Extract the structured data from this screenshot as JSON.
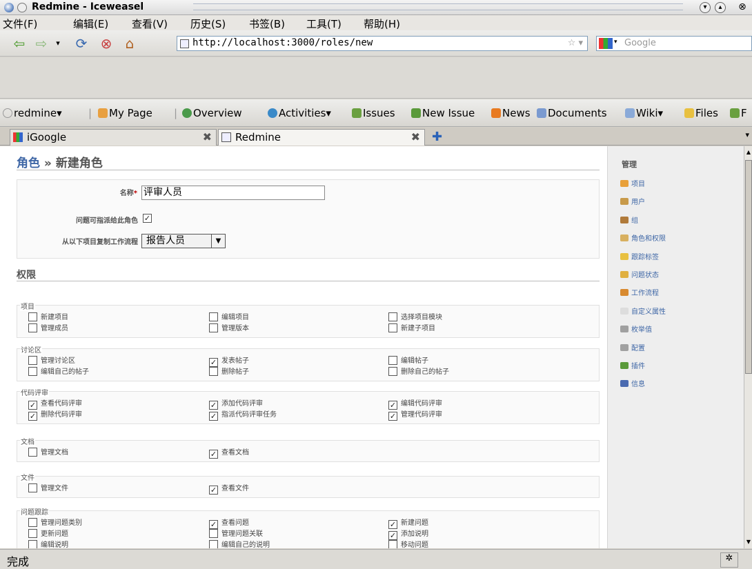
{
  "window": {
    "title": "Redmine - Iceweasel"
  },
  "menu": [
    "文件(F)",
    "编辑(E)",
    "查看(V)",
    "历史(S)",
    "书签(B)",
    "工具(T)",
    "帮助(H)"
  ],
  "nav": {
    "url": "http://localhost:3000/roles/new",
    "search_placeholder": "Google"
  },
  "bookmarks": {
    "redmine": "redmine▾",
    "my_page": "My Page",
    "overview": "Overview",
    "activities": "Activities▾",
    "issues": "Issues",
    "new_issue": "New Issue",
    "news": "News",
    "documents": "Documents",
    "wiki": "Wiki▾",
    "files": "Files",
    "more": "F"
  },
  "tabs": [
    {
      "label": "iGoogle"
    },
    {
      "label": "Redmine"
    }
  ],
  "page": {
    "crumb_link": "角色",
    "crumb_sep": "»",
    "crumb_current": "新建角色",
    "name_label": "名称",
    "name_required": "*",
    "name_value": "评审人员",
    "assignable_label": "问题可指派给此角色",
    "assignable_checked": true,
    "copy_workflow_label": "从以下项目复制工作流程",
    "copy_workflow_value": "报告人员",
    "permissions_title": "权限"
  },
  "groups": [
    {
      "legend": "项目",
      "perms": [
        {
          "label": "新建项目",
          "checked": false
        },
        {
          "label": "编辑项目",
          "checked": false
        },
        {
          "label": "选择项目模块",
          "checked": false
        },
        {
          "label": "管理成员",
          "checked": false
        },
        {
          "label": "管理版本",
          "checked": false
        },
        {
          "label": "新建子项目",
          "checked": false
        }
      ]
    },
    {
      "legend": "讨论区",
      "perms": [
        {
          "label": "管理讨论区",
          "checked": false
        },
        {
          "label": "发表帖子",
          "checked": true
        },
        {
          "label": "编辑帖子",
          "checked": false
        },
        {
          "label": "编辑自己的帖子",
          "checked": false
        },
        {
          "label": "删除帖子",
          "checked": false
        },
        {
          "label": "删除自己的帖子",
          "checked": false
        }
      ]
    },
    {
      "legend": "代码评审",
      "perms": [
        {
          "label": "查看代码评审",
          "checked": true
        },
        {
          "label": "添加代码评审",
          "checked": true
        },
        {
          "label": "编辑代码评审",
          "checked": true
        },
        {
          "label": "删除代码评审",
          "checked": true
        },
        {
          "label": "指派代码评审任务",
          "checked": true
        },
        {
          "label": "管理代码评审",
          "checked": true
        }
      ]
    },
    {
      "legend": "文档",
      "perms": [
        {
          "label": "管理文档",
          "checked": false
        },
        {
          "label": "查看文档",
          "checked": true
        }
      ]
    },
    {
      "legend": "文件",
      "perms": [
        {
          "label": "管理文件",
          "checked": false
        },
        {
          "label": "查看文件",
          "checked": true
        }
      ]
    },
    {
      "legend": "问题跟踪",
      "perms": [
        {
          "label": "管理问题类别",
          "checked": false
        },
        {
          "label": "查看问题",
          "checked": true
        },
        {
          "label": "新建问题",
          "checked": true
        },
        {
          "label": "更新问题",
          "checked": false
        },
        {
          "label": "管理问题关联",
          "checked": false
        },
        {
          "label": "添加说明",
          "checked": true
        },
        {
          "label": "编辑说明",
          "checked": false
        },
        {
          "label": "编辑自己的说明",
          "checked": false
        },
        {
          "label": "移动问题",
          "checked": false
        }
      ]
    }
  ],
  "sidebar": {
    "title": "管理",
    "items": [
      {
        "label": "项目",
        "icon": "projects-icon",
        "color": "#e8a03a"
      },
      {
        "label": "用户",
        "icon": "user-icon",
        "color": "#c89a4a"
      },
      {
        "label": "组",
        "icon": "group-icon",
        "color": "#b07a3a"
      },
      {
        "label": "角色和权限",
        "icon": "roles-icon",
        "color": "#d8b060"
      },
      {
        "label": "跟踪标签",
        "icon": "tracker-icon",
        "color": "#e8c040"
      },
      {
        "label": "问题状态",
        "icon": "status-icon",
        "color": "#e0b040"
      },
      {
        "label": "工作流程",
        "icon": "workflow-icon",
        "color": "#d88a30"
      },
      {
        "label": "自定义属性",
        "icon": "custom-field-icon",
        "color": "#dddddd"
      },
      {
        "label": "枚举值",
        "icon": "list-icon",
        "color": "#a0a0a0"
      },
      {
        "label": "配置",
        "icon": "settings-icon",
        "color": "#a0a0a0"
      },
      {
        "label": "插件",
        "icon": "plugin-icon",
        "color": "#5a9a3a"
      },
      {
        "label": "信息",
        "icon": "info-icon",
        "color": "#4a6ab0"
      }
    ]
  },
  "status_text": "完成"
}
